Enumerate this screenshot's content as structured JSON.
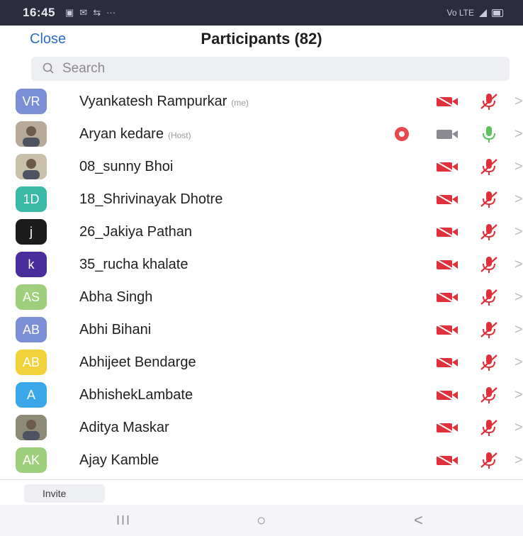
{
  "status_bar": {
    "time": "16:45",
    "left_icons": [
      "gallery-icon",
      "notification-icon",
      "network-icon"
    ],
    "more": "···",
    "right_text": "Vo LTE"
  },
  "header": {
    "close_label": "Close",
    "title": "Participants (82)"
  },
  "search": {
    "placeholder": "Search"
  },
  "participants": [
    {
      "name": "Vyankatesh Rampurkar",
      "tag": "(me)",
      "initials": "VR",
      "avatar_color": "#7b8fd6",
      "avatar_type": "initials",
      "video": "off",
      "mic": "muted"
    },
    {
      "name": "Aryan kedare",
      "tag": "(Host)",
      "initials": "",
      "avatar_color": "#b7aa98",
      "avatar_type": "photo",
      "video": "on",
      "mic": "on",
      "recording": true
    },
    {
      "name": "08_sunny Bhoi",
      "tag": "",
      "initials": "",
      "avatar_color": "#c9c0a9",
      "avatar_type": "photo",
      "video": "off",
      "mic": "muted"
    },
    {
      "name": "18_Shrivinayak Dhotre",
      "tag": "",
      "initials": "1D",
      "avatar_color": "#3bb9a7",
      "avatar_type": "initials",
      "video": "off",
      "mic": "muted"
    },
    {
      "name": "26_Jakiya Pathan",
      "tag": "",
      "initials": "j",
      "avatar_color": "#1c1c1c",
      "avatar_type": "initials",
      "video": "off",
      "mic": "muted"
    },
    {
      "name": "35_rucha khalate",
      "tag": "",
      "initials": "k",
      "avatar_color": "#4a2d9c",
      "avatar_type": "initials",
      "video": "off",
      "mic": "muted"
    },
    {
      "name": "Abha Singh",
      "tag": "",
      "initials": "AS",
      "avatar_color": "#9dcf7c",
      "avatar_type": "initials",
      "video": "off",
      "mic": "muted"
    },
    {
      "name": "Abhi Bihani",
      "tag": "",
      "initials": "AB",
      "avatar_color": "#7b8fd6",
      "avatar_type": "initials",
      "video": "off",
      "mic": "muted"
    },
    {
      "name": "Abhijeet Bendarge",
      "tag": "",
      "initials": "AB",
      "avatar_color": "#f2d23a",
      "avatar_type": "initials",
      "video": "off",
      "mic": "muted"
    },
    {
      "name": "AbhishekLambate",
      "tag": "",
      "initials": "A",
      "avatar_color": "#3aa8e8",
      "avatar_type": "initials",
      "video": "off",
      "mic": "muted"
    },
    {
      "name": "Aditya Maskar",
      "tag": "",
      "initials": "",
      "avatar_color": "#8d8a76",
      "avatar_type": "photo",
      "video": "off",
      "mic": "muted"
    },
    {
      "name": "Ajay Kamble",
      "tag": "",
      "initials": "AK",
      "avatar_color": "#9dcf7c",
      "avatar_type": "initials",
      "video": "off",
      "mic": "muted"
    }
  ],
  "footer": {
    "invite_label": "Invite"
  },
  "system_nav": {
    "recents": "III",
    "home": "○",
    "back": "<"
  },
  "colors": {
    "accent": "#2d6cc8",
    "muted_red": "#e0303c",
    "mic_on_green": "#5cc35c",
    "video_on_gray": "#8a8a92",
    "record_red": "#e8474d"
  }
}
